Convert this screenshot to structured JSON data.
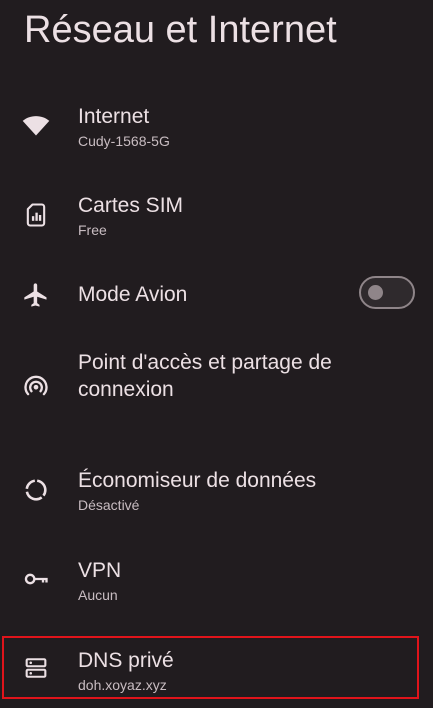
{
  "page": {
    "title": "Réseau et Internet"
  },
  "items": [
    {
      "label": "Internet",
      "summary": "Cudy-1568-5G",
      "icon": "wifi-icon"
    },
    {
      "label": "Cartes SIM",
      "summary": "Free",
      "icon": "sim-card-icon"
    },
    {
      "label": "Mode Avion",
      "icon": "airplane-icon",
      "toggle_on": false
    },
    {
      "label": "Point d'accès et partage de connexion",
      "icon": "hotspot-icon"
    },
    {
      "label": "Économiseur de données",
      "summary": "Désactivé",
      "icon": "data-saver-icon"
    },
    {
      "label": "VPN",
      "summary": "Aucun",
      "icon": "vpn-key-icon"
    },
    {
      "label": "DNS privé",
      "summary": "doh.xoyaz.xyz",
      "icon": "dns-icon"
    }
  ],
  "colors": {
    "background": "#211c1f",
    "text_primary": "#ece0e4",
    "text_secondary": "#c8bcc1",
    "highlight_border": "#e0141b"
  }
}
